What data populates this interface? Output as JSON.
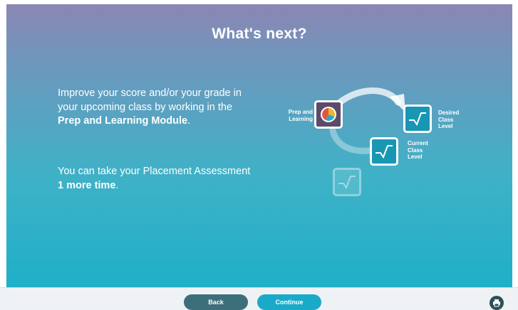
{
  "main": {
    "title": "What's next?",
    "para1": {
      "text_a": "Improve your score and/or your grade in your upcoming class by working in the ",
      "bold": "Prep and Learning Module",
      "text_b": "."
    },
    "para2": {
      "text_a": "You can take your Placement Assessment ",
      "bold": "1 more time",
      "text_b": "."
    }
  },
  "diagram": {
    "prep_label": "Prep and Learning",
    "desired_label": "Desired Class Level",
    "current_label": "Current Class Level",
    "icons": [
      "pie-chart-icon",
      "check-graph-icon",
      "check-graph-icon",
      "check-graph-icon"
    ]
  },
  "footer": {
    "back_label": "Back",
    "continue_label": "Continue",
    "print_icon": "printer-icon"
  },
  "colors": {
    "gradient_top": "#8b86b3",
    "gradient_bottom": "#1fb0c8",
    "back_button": "#3d6f7a",
    "continue_button": "#19aac9",
    "tile": "#1797b4",
    "prep_tile": "#5b4a6a"
  }
}
